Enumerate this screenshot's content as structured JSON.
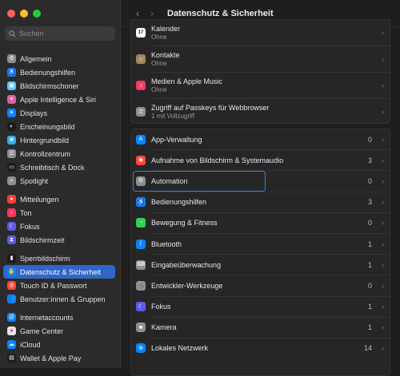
{
  "window": {
    "title": "Datenschutz & Sicherheit",
    "traffic_colors": {
      "close": "#fe5f57",
      "minimize": "#febc2e",
      "zoom": "#28c840"
    }
  },
  "search": {
    "placeholder": "Suchen"
  },
  "sidebar": {
    "groups": [
      [
        {
          "label": "Allgemein",
          "icon": "gear-icon",
          "color": "#8e8e93",
          "glyph": "⚙"
        },
        {
          "label": "Bedienungshilfen",
          "icon": "accessibility-icon",
          "color": "#0a84ff",
          "glyph": "♿"
        },
        {
          "label": "Bildschirmschoner",
          "icon": "screensaver-icon",
          "color": "#5ac8fa",
          "glyph": "▣"
        },
        {
          "label": "Apple Intelligence & Siri",
          "icon": "siri-icon",
          "color": "#e0609a",
          "glyph": "✦"
        },
        {
          "label": "Displays",
          "icon": "display-icon",
          "color": "#0a84ff",
          "glyph": "☀"
        },
        {
          "label": "Erscheinungsbild",
          "icon": "appearance-icon",
          "color": "#1c1c1e",
          "glyph": "◐"
        },
        {
          "label": "Hintergrundbild",
          "icon": "wallpaper-icon",
          "color": "#32ade6",
          "glyph": "❀"
        },
        {
          "label": "Kontrollzentrum",
          "icon": "control-center-icon",
          "color": "#8e8e93",
          "glyph": "☰"
        },
        {
          "label": "Schreibtisch & Dock",
          "icon": "dock-icon",
          "color": "#1c1c1e",
          "glyph": "▭"
        },
        {
          "label": "Spotlight",
          "icon": "spotlight-icon",
          "color": "#8e8e93",
          "glyph": "⌕"
        }
      ],
      [
        {
          "label": "Mitteilungen",
          "icon": "notifications-icon",
          "color": "#ff3b30",
          "glyph": "●"
        },
        {
          "label": "Ton",
          "icon": "sound-icon",
          "color": "#ff375f",
          "glyph": "♪"
        },
        {
          "label": "Fokus",
          "icon": "focus-icon",
          "color": "#5e5ce6",
          "glyph": "☾"
        },
        {
          "label": "Bildschirmzeit",
          "icon": "screen-time-icon",
          "color": "#5e5ce6",
          "glyph": "⧗"
        }
      ],
      [
        {
          "label": "Sperrbildschirm",
          "icon": "lock-screen-icon",
          "color": "#1c1c1e",
          "glyph": "▮"
        },
        {
          "label": "Datenschutz & Sicherheit",
          "icon": "privacy-hand-icon",
          "color": "#0a84ff",
          "glyph": "✋",
          "active": true
        },
        {
          "label": "Touch ID & Passwort",
          "icon": "touch-id-icon",
          "color": "#ff453a",
          "glyph": "◎"
        },
        {
          "label": "Benutzer:innen & Gruppen",
          "icon": "users-icon",
          "color": "#0a84ff",
          "glyph": "👥"
        }
      ],
      [
        {
          "label": "Internetaccounts",
          "icon": "internet-accounts-icon",
          "color": "#0a84ff",
          "glyph": "@"
        },
        {
          "label": "Game Center",
          "icon": "game-center-icon",
          "color": "#e5e5ea",
          "glyph": "●"
        },
        {
          "label": "iCloud",
          "icon": "icloud-icon",
          "color": "#0a84ff",
          "glyph": "☁"
        },
        {
          "label": "Wallet & Apple Pay",
          "icon": "wallet-icon",
          "color": "#1c1c1e",
          "glyph": "▤"
        }
      ]
    ]
  },
  "main": {
    "top_rows": [
      {
        "label": "Kalender",
        "sub": "Ohne",
        "icon": "calendar-icon",
        "color": "#ffffff",
        "glyph": "17",
        "glyph_color": "#222"
      },
      {
        "label": "Kontakte",
        "sub": "Ohne",
        "icon": "contacts-icon",
        "color": "#a2845e",
        "glyph": "☺"
      },
      {
        "label": "Medien & Apple Music",
        "sub": "Ohne",
        "icon": "music-icon",
        "color": "#ff375f",
        "glyph": "♫"
      },
      {
        "label": "Zugriff auf Passkeys für Webbrowser",
        "sub": "1 mit Vollzugriff",
        "icon": "passkeys-icon",
        "color": "#8e8e93",
        "glyph": "⚿"
      }
    ],
    "rows": [
      {
        "label": "App-Verwaltung",
        "count": "0",
        "icon": "app-store-icon",
        "color": "#0a84ff",
        "glyph": "A"
      },
      {
        "label": "Aufnahme von Bildschirm & Systemaudio",
        "count": "3",
        "icon": "screen-recording-icon",
        "color": "#ff453a",
        "glyph": "◉"
      },
      {
        "label": "Automation",
        "count": "0",
        "icon": "automation-gear-icon",
        "color": "#8e8e93",
        "glyph": "⚙"
      },
      {
        "label": "Bedienungshilfen",
        "count": "3",
        "icon": "accessibility-icon",
        "color": "#0a84ff",
        "glyph": "♿"
      },
      {
        "label": "Bewegung & Fitness",
        "count": "0",
        "icon": "fitness-icon",
        "color": "#30d158",
        "glyph": "◔"
      },
      {
        "label": "Bluetooth",
        "count": "1",
        "icon": "bluetooth-icon",
        "color": "#0a84ff",
        "glyph": "ᛒ"
      },
      {
        "label": "Eingabeüberwachung",
        "count": "1",
        "icon": "keyboard-icon",
        "color": "#8e8e93",
        "glyph": "⌨"
      },
      {
        "label": "Entwickler-Werkzeuge",
        "count": "0",
        "icon": "developer-tools-icon",
        "color": "#8e8e93",
        "glyph": "🔨"
      },
      {
        "label": "Fokus",
        "count": "1",
        "icon": "focus-icon",
        "color": "#5e5ce6",
        "glyph": "☾"
      },
      {
        "label": "Kamera",
        "count": "1",
        "icon": "camera-icon",
        "color": "#8e8e93",
        "glyph": "■"
      },
      {
        "label": "Lokales Netzwerk",
        "count": "14",
        "icon": "network-icon",
        "color": "#0a84ff",
        "glyph": "⊕"
      }
    ],
    "highlighted_row": "Automation"
  }
}
